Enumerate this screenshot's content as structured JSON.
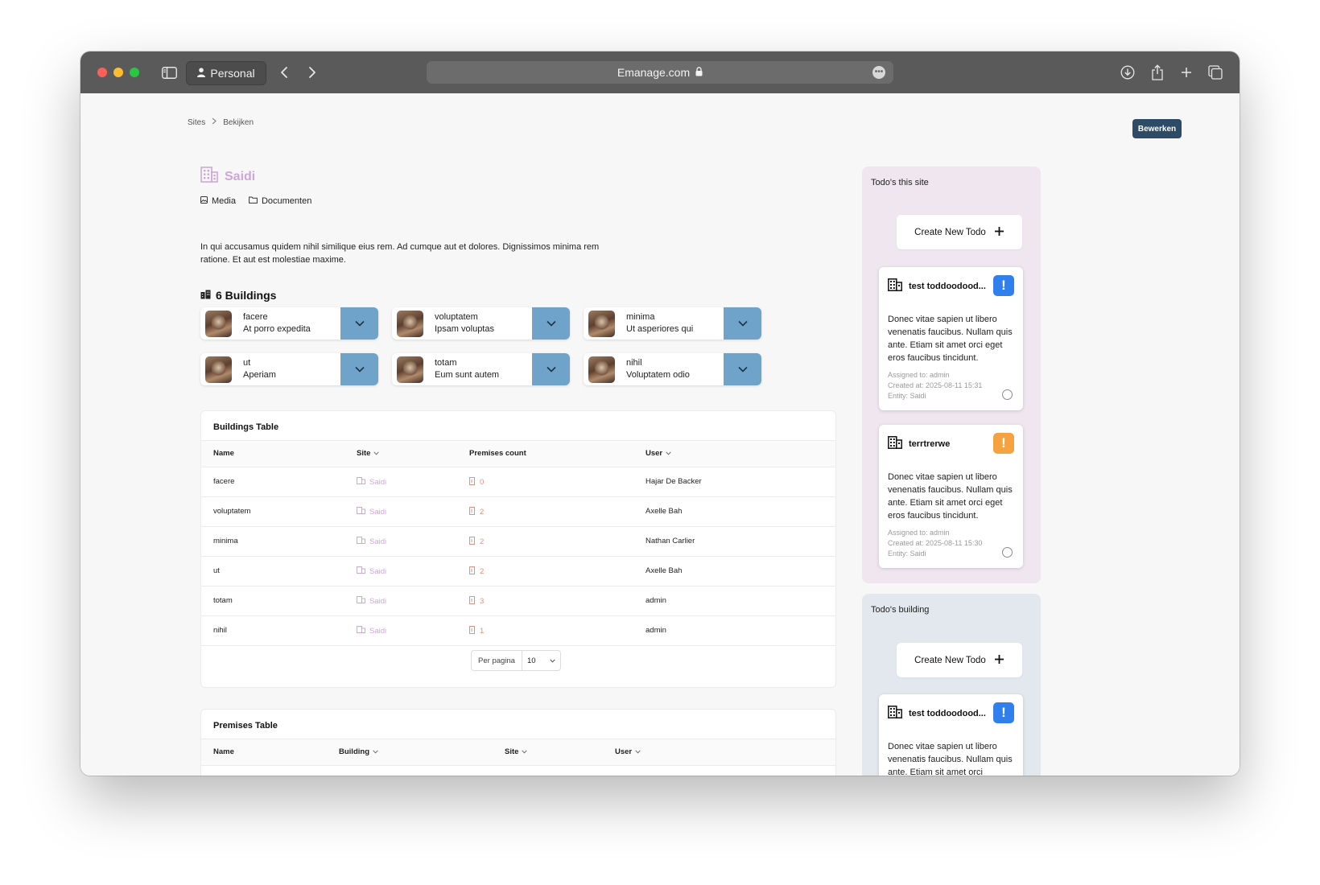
{
  "browser": {
    "profile_label": "Personal",
    "url": "Emanage.com"
  },
  "breadcrumb": {
    "root": "Sites",
    "current": "Bekijken"
  },
  "edit_button": "Bewerken",
  "site": {
    "name": "Saidi",
    "links": {
      "media": "Media",
      "documents": "Documenten"
    },
    "description": "In qui accusamus quidem nihil similique eius rem. Ad cumque aut et dolores. Dignissimos minima rem ratione. Et aut est molestiae maxime."
  },
  "buildings": {
    "heading": "6 Buildings",
    "cards": [
      {
        "name": "facere",
        "subtitle": "At porro expedita"
      },
      {
        "name": "voluptatem",
        "subtitle": "Ipsam voluptas"
      },
      {
        "name": "minima",
        "subtitle": "Ut asperiores qui"
      },
      {
        "name": "ut",
        "subtitle": "Aperiam"
      },
      {
        "name": "totam",
        "subtitle": "Eum sunt autem"
      },
      {
        "name": "nihil",
        "subtitle": "Voluptatem odio"
      }
    ]
  },
  "buildings_table": {
    "title": "Buildings Table",
    "columns": {
      "name": "Name",
      "site": "Site",
      "premises": "Premises count",
      "user": "User"
    },
    "rows": [
      {
        "name": "facere",
        "site": "Saidi",
        "count": "0",
        "user": "Hajar De Backer"
      },
      {
        "name": "voluptatem",
        "site": "Saidi",
        "count": "2",
        "user": "Axelle Bah"
      },
      {
        "name": "minima",
        "site": "Saidi",
        "count": "2",
        "user": "Nathan Carlier"
      },
      {
        "name": "ut",
        "site": "Saidi",
        "count": "2",
        "user": "Axelle Bah"
      },
      {
        "name": "totam",
        "site": "Saidi",
        "count": "3",
        "user": "admin"
      },
      {
        "name": "nihil",
        "site": "Saidi",
        "count": "1",
        "user": "admin"
      }
    ],
    "pager": {
      "label": "Per pagina",
      "value": "10"
    }
  },
  "premises_table": {
    "title": "Premises Table",
    "columns": {
      "name": "Name",
      "building": "Building",
      "site": "Site",
      "user": "User"
    }
  },
  "todos_site": {
    "header": "Todo's this site",
    "create_label": "Create New Todo",
    "cards": [
      {
        "title": "test toddoodood...",
        "priority_color": "#2f80ed",
        "body": "Donec vitae sapien ut libero venenatis faucibus. Nullam quis ante. Etiam sit amet orci eget eros faucibus tincidunt.",
        "assigned": "Assigned to: admin",
        "created": "Created at: 2025-08-11 15:31",
        "entity": "Entity: Saidi"
      },
      {
        "title": "terrtrerwe",
        "priority_color": "#f5a340",
        "body": "Donec vitae sapien ut libero venenatis faucibus. Nullam quis ante. Etiam sit amet orci eget eros faucibus tincidunt.",
        "assigned": "Assigned to: admin",
        "created": "Created at: 2025-08-11 15:30",
        "entity": "Entity: Saidi"
      }
    ]
  },
  "todos_building": {
    "header": "Todo's building",
    "create_label": "Create New Todo",
    "cards": [
      {
        "title": "test toddoodood...",
        "priority_color": "#2f80ed",
        "body": "Donec vitae sapien ut libero venenatis faucibus. Nullam quis ante. Etiam sit amet orci"
      }
    ]
  },
  "colors": {
    "site_box_bg": "#efe6ef",
    "building_box_bg": "#e2e8ee",
    "accent_dark": "#2d4a66",
    "dropdown_blue": "#6fa3c9",
    "site_pink": "#d0a6d8",
    "count_salmon": "#ee8c7c"
  }
}
